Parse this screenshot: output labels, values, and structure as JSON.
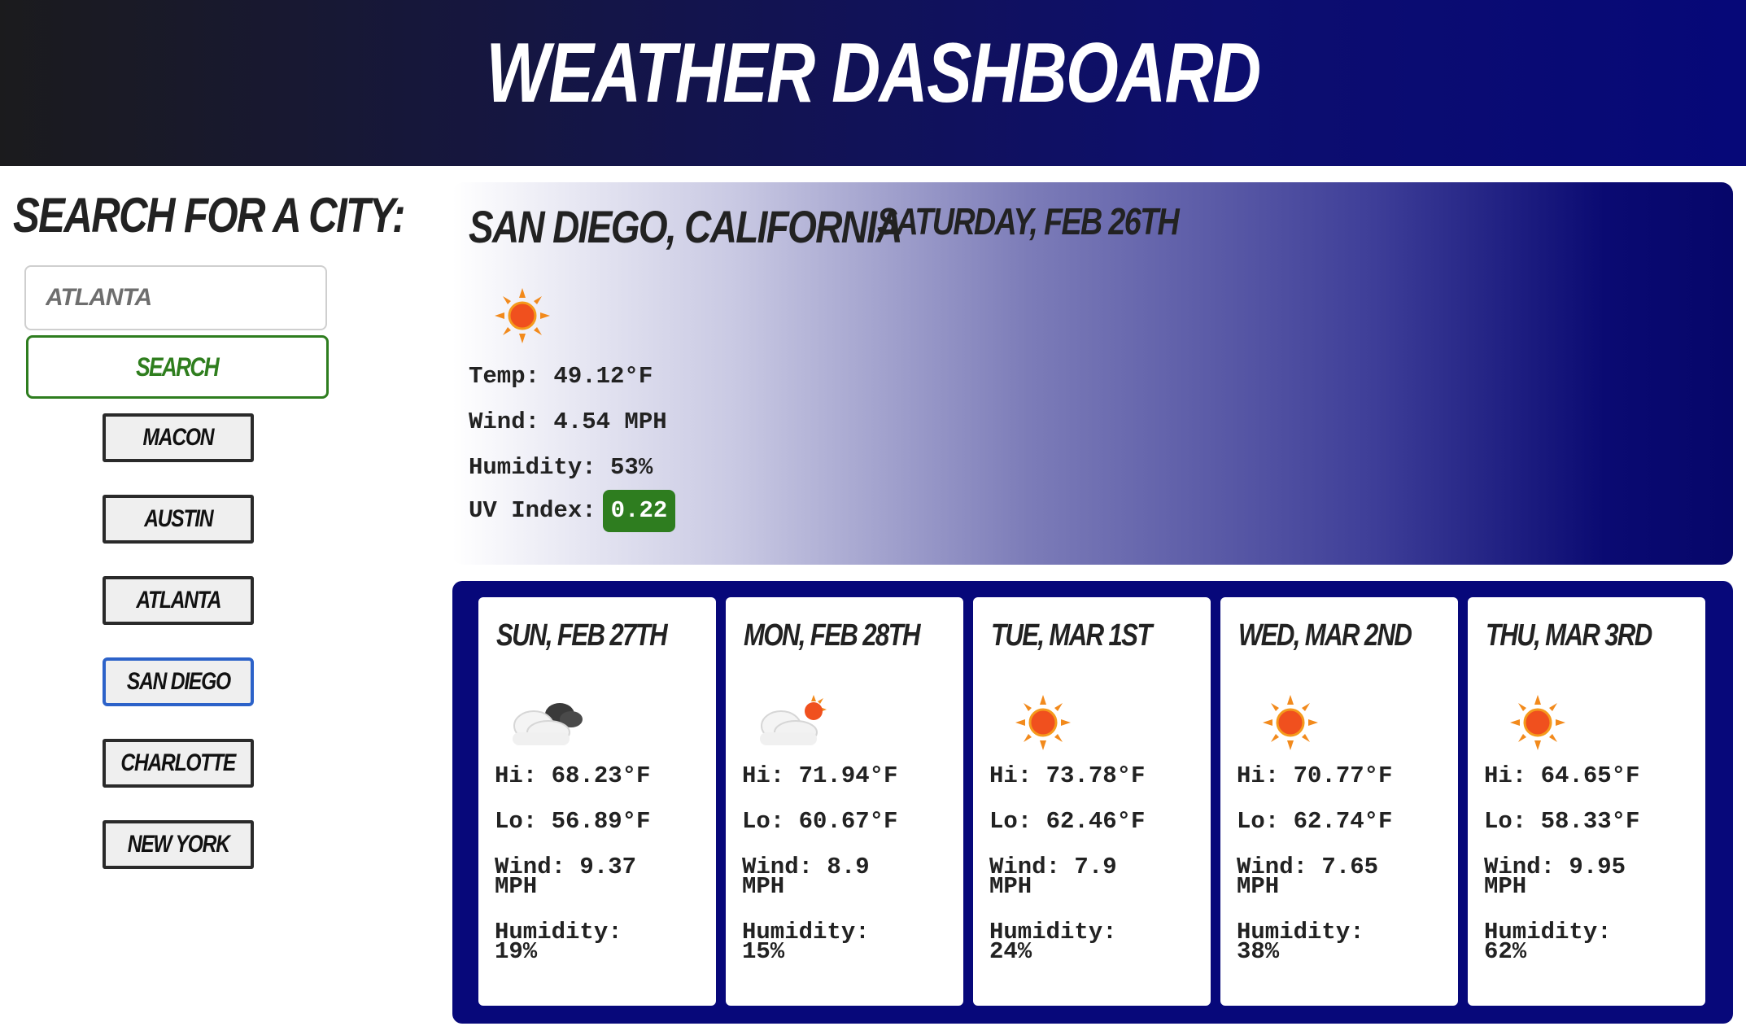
{
  "header": {
    "title": "Weather Dashboard"
  },
  "sidebar": {
    "title": "Search for a City:",
    "search": {
      "placeholder": "Atlanta",
      "button_label": "Search"
    },
    "cities": [
      {
        "label": "Macon",
        "active": false
      },
      {
        "label": "Austin",
        "active": false
      },
      {
        "label": "Atlanta",
        "active": false
      },
      {
        "label": "San Diego",
        "active": true
      },
      {
        "label": "Charlotte",
        "active": false
      },
      {
        "label": "New York",
        "active": false
      }
    ]
  },
  "current": {
    "city": "San Diego, California",
    "date": "Saturday, Feb 26th",
    "icon": "sun-icon",
    "temp": "Temp: 49.12°F",
    "wind": "Wind: 4.54 MPH",
    "humidity": "Humidity: 53%",
    "uv_label": "UV Index:",
    "uv_value": "0.22",
    "uv_color": "#2e7d1f"
  },
  "forecast": [
    {
      "date": "Sun, Feb 27th",
      "icon": "cloudy-dark-icon",
      "hi": "Hi: 68.23°F",
      "lo": "Lo: 56.89°F",
      "wind_1": "Wind: 9.37",
      "wind_2": "MPH",
      "hum_1": "Humidity:",
      "hum_2": "19%"
    },
    {
      "date": "Mon, Feb 28th",
      "icon": "partly-sunny-icon",
      "hi": "Hi: 71.94°F",
      "lo": "Lo: 60.67°F",
      "wind_1": "Wind: 8.9",
      "wind_2": "MPH",
      "hum_1": "Humidity:",
      "hum_2": "15%"
    },
    {
      "date": "Tue, Mar 1st",
      "icon": "sun-icon",
      "hi": "Hi: 73.78°F",
      "lo": "Lo: 62.46°F",
      "wind_1": "Wind: 7.9",
      "wind_2": "MPH",
      "hum_1": "Humidity:",
      "hum_2": "24%"
    },
    {
      "date": "Wed, Mar 2nd",
      "icon": "sun-icon",
      "hi": "Hi: 70.77°F",
      "lo": "Lo: 62.74°F",
      "wind_1": "Wind: 7.65",
      "wind_2": "MPH",
      "hum_1": "Humidity:",
      "hum_2": "38%"
    },
    {
      "date": "Thu, Mar 3rd",
      "icon": "sun-icon",
      "hi": "Hi: 64.65°F",
      "lo": "Lo: 58.33°F",
      "wind_1": "Wind: 9.95",
      "wind_2": "MPH",
      "hum_1": "Humidity:",
      "hum_2": "62%"
    }
  ],
  "colors": {
    "header_dark": "#1b1b1d",
    "header_blue": "#060878",
    "search_green": "#2e7d1f",
    "active_city_border": "#2c62c9",
    "forecast_bg": "#07087a"
  }
}
